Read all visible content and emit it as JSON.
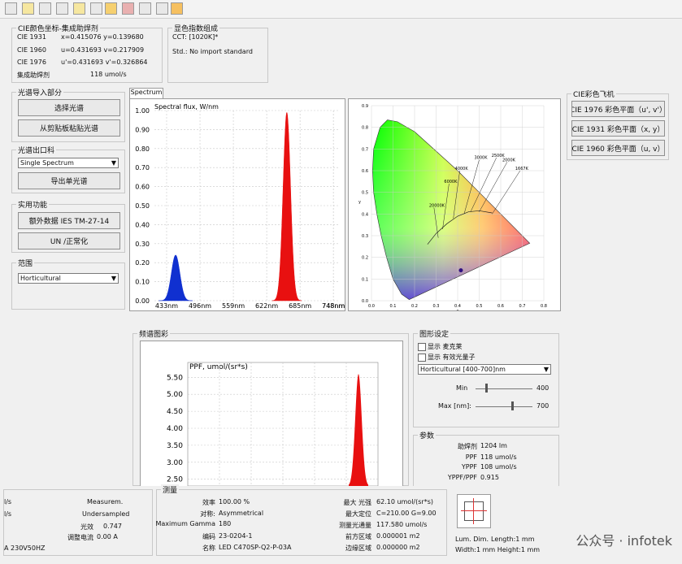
{
  "toolbar": {
    "icons": [
      "open-icon",
      "chart-icon",
      "table-icon",
      "document-icon",
      "edit-icon",
      "save-icon",
      "warning-icon",
      "camera-icon",
      "image-icon",
      "calculator-icon",
      "paste-icon"
    ]
  },
  "cie_coords": {
    "title": "CIE颜色坐标-集成助焊剂",
    "rows": [
      {
        "label": "CIE 1931",
        "value": "x=0.415076 y=0.139680"
      },
      {
        "label": "CIE 1960",
        "value": "u=0.431693 v=0.217909"
      },
      {
        "label": "CIE 1976",
        "value": "u'=0.431693 v'=0.326864"
      },
      {
        "label": "集成助焊剂",
        "value": "118 umol/s"
      }
    ]
  },
  "color_index": {
    "title": "显色指数组成",
    "cct": "CCT: [1020K]*",
    "std": "Std.: No import standard"
  },
  "spectrum_import": {
    "title": "光谱导入部分",
    "select_btn": "选择光谱",
    "paste_btn": "从剪贴板粘贴光谱"
  },
  "spectrum_export": {
    "title": "光谱出口科",
    "dropdown": "Single Spectrum",
    "export_btn": "导出单光谱"
  },
  "utility": {
    "title": "实用功能",
    "ies_btn": "额外数据 IES TM-27-14",
    "normalize_btn": "UN /正常化"
  },
  "range": {
    "title": "范围",
    "dropdown": "Horticultural"
  },
  "spectrum_tab": {
    "label": "Spectrum"
  },
  "spectrum_chart": {
    "chart_data": {
      "type": "area",
      "title": "Spectral flux, W/nm",
      "xlabel": "",
      "ylabel": "",
      "x_ticks": [
        "433nm",
        "496nm",
        "559nm",
        "622nm",
        "685nm",
        "748nm",
        "748nm"
      ],
      "y_ticks": [
        "1.00",
        "0.90",
        "0.80",
        "0.70",
        "0.60",
        "0.50",
        "0.40",
        "0.30",
        "0.20",
        "0.10",
        "0.00"
      ],
      "ylim": [
        0,
        1.0
      ],
      "xlim": [
        410,
        760
      ],
      "series": [
        {
          "peaks": [
            {
              "center": 450,
              "height": 0.24,
              "width": 8,
              "color": "#1030d0"
            },
            {
              "center": 660,
              "height": 0.99,
              "width": 7,
              "color": "#e81010"
            }
          ]
        }
      ]
    }
  },
  "cie_chart": {
    "x_ticks": [
      "0.0",
      "0.1",
      "0.2",
      "0.3",
      "0.4",
      "0.5",
      "0.6",
      "0.7",
      "0.8"
    ],
    "y_ticks": [
      "0.0",
      "0.1",
      "0.2",
      "0.3",
      "0.4",
      "0.5",
      "0.6",
      "0.7",
      "0.8",
      "0.9"
    ],
    "xlabel": "x",
    "ylabel": "y",
    "cct_labels": [
      "20000K",
      "6000K",
      "4000K",
      "3000K",
      "2500K",
      "2000K",
      "1667K"
    ],
    "point": {
      "x": 0.415,
      "y": 0.14
    }
  },
  "cie_plane": {
    "title": "CIE彩色飞机",
    "btn1976": "CIE 1976 彩色平面（u', v'）",
    "btn1931": "CIE 1931 彩色平面（x, y）",
    "btn1960": "CIE 1960 彩色平面（u, v）"
  },
  "freq_chart": {
    "title": "频谱图彩",
    "chart_data": {
      "type": "area",
      "title": "PPF, umol/(sr*s)",
      "y_ticks": [
        "5.50",
        "5.00",
        "4.50",
        "4.00",
        "3.50",
        "3.00",
        "2.50"
      ],
      "ylim": [
        2.3,
        5.7
      ],
      "series": [
        {
          "peaks": [
            {
              "center": 660,
              "height": 5.6,
              "width": 5,
              "color": "#e81010"
            }
          ]
        }
      ]
    }
  },
  "graph_settings": {
    "title": "图形设定",
    "show_mcree": "显示 麦克莱",
    "show_quantum": "显示 有效光量子",
    "dropdown": "Horticultural [400-700]nm",
    "min_label": "Min",
    "min_value": "400",
    "max_label": "Max [nm]:",
    "max_value": "700"
  },
  "params": {
    "title": "参数",
    "rows": [
      {
        "label": "助焊剂",
        "value": "1204 lm"
      },
      {
        "label": "PPF",
        "value": "118 umol/s"
      },
      {
        "label": "YPPF",
        "value": "108 umol/s"
      },
      {
        "label": "YPPF/PPF",
        "value": "0.915"
      }
    ]
  },
  "status_left": {
    "unit1": "l/s",
    "unit2": "l/s",
    "measurem_label": "Measurem.",
    "undersampled": "Undersampled",
    "pf_label": "光效",
    "pf_value": "0.747",
    "current_label": "调整电流",
    "current_value": "0.00 A",
    "voltage": "A 230V50HZ"
  },
  "measure": {
    "title": "测量",
    "rows_left": [
      {
        "label": "效率",
        "value": "100.00 %"
      },
      {
        "label": "对称:",
        "value": "Asymmetrical"
      },
      {
        "label": "Maximum Gamma",
        "value": "180"
      },
      {
        "label": "编码",
        "value": "23-0204-1"
      },
      {
        "label": "名称",
        "value": "LED C470SP-Q2-P-03A"
      }
    ],
    "rows_right": [
      {
        "label": "最大 光强",
        "value": "62.10  umol/(sr*s)"
      },
      {
        "label": "最大定位",
        "value": "C=210.00 G=9.00"
      },
      {
        "label": "测量光通量",
        "value": "117.580 umol/s"
      },
      {
        "label": "前方区域",
        "value": "0.000001 m2"
      },
      {
        "label": "边缘区域",
        "value": "0.000000 m2"
      }
    ]
  },
  "lum": {
    "dim_label": "Lum. Dim.",
    "length": "Length:1 mm",
    "width_height": "Width:1 mm Height:1 mm"
  },
  "watermark": "公众号 · infotek"
}
